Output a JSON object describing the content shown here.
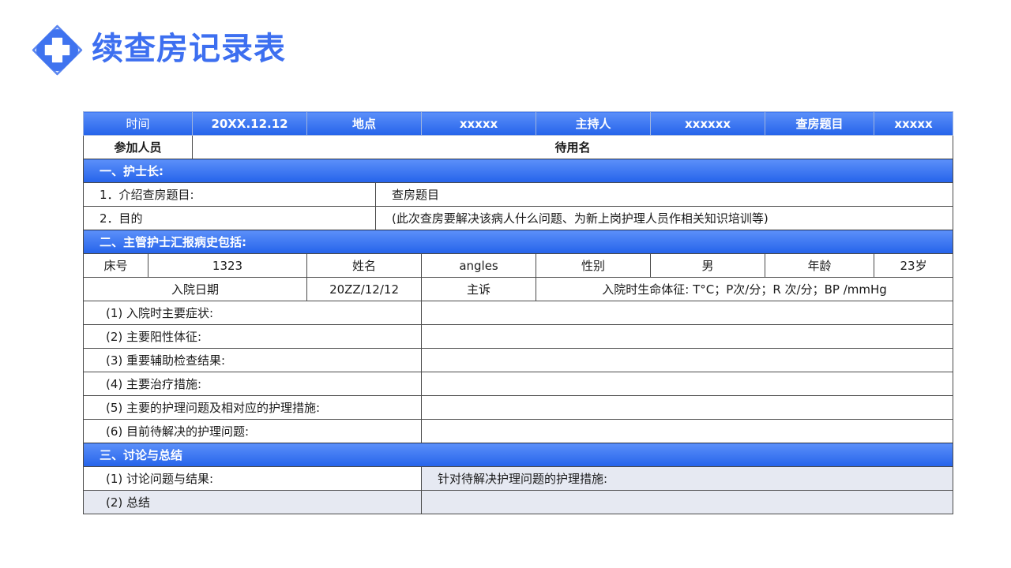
{
  "title": "续查房记录表",
  "colors": {
    "accent": "#3d6ff0",
    "header_bg": "#2f6ef0",
    "shade_bg": "#e6e9f2"
  },
  "icon": "medical-cross-icon",
  "header": {
    "time_label": "时间",
    "time_value": "20XX.12.12",
    "place_label": "地点",
    "place_value": "xxxxx",
    "host_label": "主持人",
    "host_value": "xxxxxx",
    "topic_label": "查房题目",
    "topic_value": "xxxxx"
  },
  "attendees": {
    "label": "参加人员",
    "value": "待用名"
  },
  "section1": {
    "title": "一、护士长:",
    "rows": [
      {
        "label": "1．介绍查房题目:",
        "value": "查房题目"
      },
      {
        "label": "2．目的",
        "value": "(此次查房要解决该病人什么问题、为新上岗护理人员作相关知识培训等)"
      }
    ]
  },
  "section2": {
    "title": "二、主管护士汇报病史包括:",
    "bed_label": "床号",
    "bed_value": "1323",
    "name_label": "姓名",
    "name_value": "angles",
    "gender_label": "性别",
    "gender_value": "男",
    "age_label": "年龄",
    "age_value": "23岁",
    "admit_label": "入院日期",
    "admit_value": "20ZZ/12/12",
    "complaint_label": "主诉",
    "vitals": "入院时生命体征: T°C；P次/分；R 次/分；BP /mmHg",
    "items": [
      "(1) 入院时主要症状:",
      "(2) 主要阳性体征:",
      "(3) 重要辅助检查结果:",
      "(4) 主要治疗措施:",
      "(5) 主要的护理问题及相对应的护理措施:",
      "(6) 目前待解决的护理问题:"
    ]
  },
  "section3": {
    "title": "三、讨论与总结",
    "discussion_label": "(1) 讨论问题与结果:",
    "measures_label": "针对待解决护理问题的护理措施:",
    "summary_label": "(2) 总结"
  }
}
